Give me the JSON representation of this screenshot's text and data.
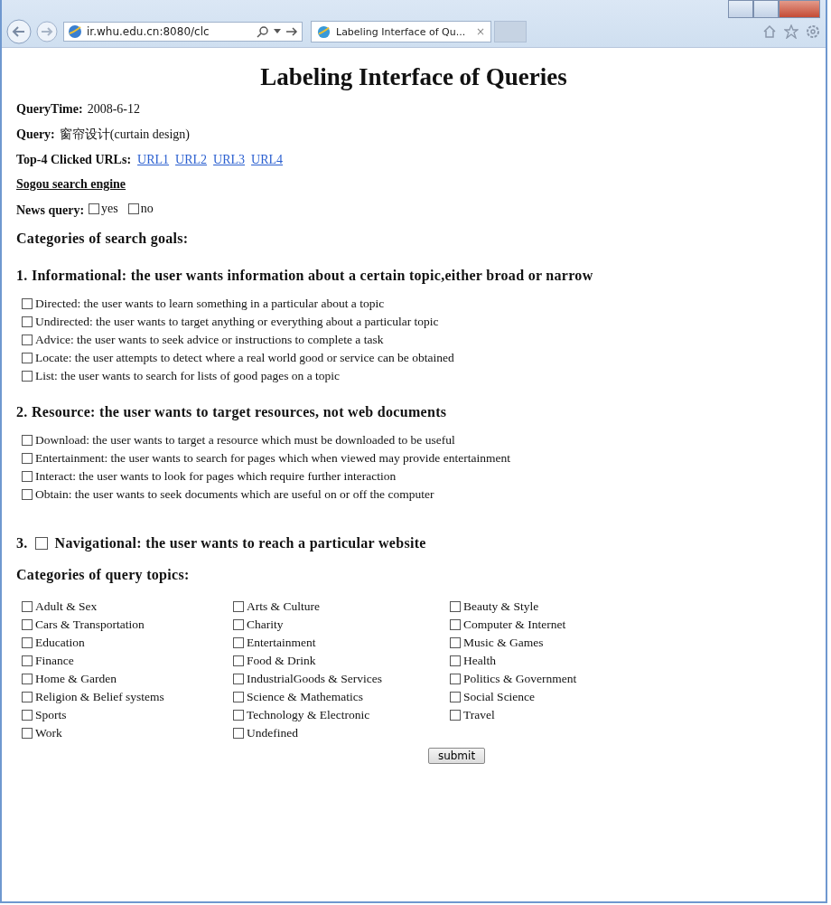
{
  "browser": {
    "address": "ir.whu.edu.cn:8080/clc",
    "tab_title": "Labeling Interface of Qu...",
    "tab_close": "×"
  },
  "page": {
    "title": "Labeling Interface of Queries",
    "fields": [
      {
        "label": "QueryTime:",
        "value": "2008-6-12"
      },
      {
        "label": "Query:",
        "value": "窗帘设计(curtain design)"
      }
    ],
    "clicked_urls": {
      "label": "Top-4 Clicked URLs:",
      "links": [
        "URL1",
        "URL2",
        "URL3",
        "URL4"
      ]
    },
    "engine_link": "Sogou search engine",
    "news_query": {
      "label": "News query:",
      "options": [
        {
          "label": "yes",
          "checked": false
        },
        {
          "label": "no",
          "checked": false
        }
      ]
    },
    "goals_heading": "Categories of search goals:",
    "goal_groups": [
      {
        "kind": "options",
        "heading": "1. Informational: the user wants information about a certain topic,either broad or narrow",
        "options": [
          {
            "label": "Directed: the user wants to learn something in a particular about a topic",
            "checked": false
          },
          {
            "label": "Undirected: the user wants to target anything or everything about a particular topic",
            "checked": false
          },
          {
            "label": "Advice: the user wants to seek advice or instructions to complete a task",
            "checked": false
          },
          {
            "label": "Locate: the user attempts to detect where a real world good or service can be obtained",
            "checked": false
          },
          {
            "label": "List: the user wants to search for lists of good pages on a topic",
            "checked": false
          }
        ]
      },
      {
        "kind": "options",
        "heading": "2. Resource: the user wants to target resources, not web documents",
        "options": [
          {
            "label": "Download: the user wants to target a resource which must be downloaded to be useful",
            "checked": false
          },
          {
            "label": "Entertainment: the user wants to search for pages which when viewed may provide entertainment",
            "checked": false
          },
          {
            "label": "Interact: the user wants to look for pages which require further interaction",
            "checked": false
          },
          {
            "label": "Obtain: the user wants to seek documents which are useful on or off the computer",
            "checked": false
          }
        ]
      },
      {
        "kind": "checkbox_heading",
        "number": "3.",
        "heading": "Navigational: the user wants to reach a particular website",
        "checked": false
      }
    ],
    "topics_heading": "Categories of query topics:",
    "topics": [
      {
        "label": "Adult & Sex",
        "checked": false
      },
      {
        "label": "Arts & Culture",
        "checked": false
      },
      {
        "label": "Beauty & Style",
        "checked": false
      },
      {
        "label": "Cars & Transportation",
        "checked": false
      },
      {
        "label": "Charity",
        "checked": false
      },
      {
        "label": "Computer & Internet",
        "checked": false
      },
      {
        "label": "Education",
        "checked": false
      },
      {
        "label": "Entertainment",
        "checked": false
      },
      {
        "label": "Music & Games",
        "checked": false
      },
      {
        "label": "Finance",
        "checked": false
      },
      {
        "label": "Food & Drink",
        "checked": false
      },
      {
        "label": "Health",
        "checked": false
      },
      {
        "label": "Home & Garden",
        "checked": false
      },
      {
        "label": "IndustrialGoods & Services",
        "checked": false
      },
      {
        "label": "Politics & Government",
        "checked": false
      },
      {
        "label": "Religion & Belief systems",
        "checked": false
      },
      {
        "label": "Science & Mathematics",
        "checked": false
      },
      {
        "label": "Social Science",
        "checked": false
      },
      {
        "label": "Sports",
        "checked": false
      },
      {
        "label": "Technology & Electronic",
        "checked": false
      },
      {
        "label": "Travel",
        "checked": false
      },
      {
        "label": "Work",
        "checked": false
      },
      {
        "label": "Undefined",
        "checked": false
      }
    ],
    "submit": "submit"
  }
}
